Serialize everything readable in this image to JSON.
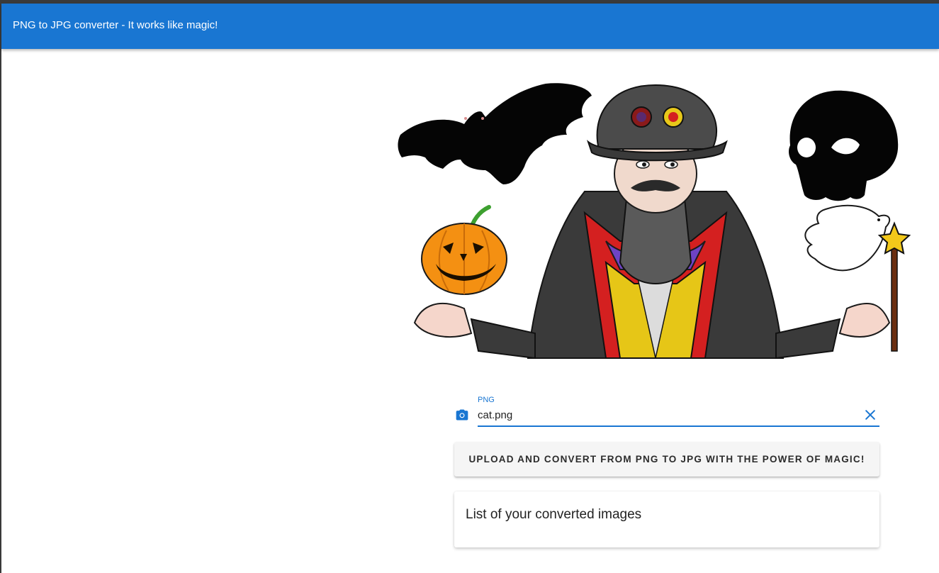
{
  "app": {
    "title": "PNG to JPG converter - It works like magic!"
  },
  "hero": {
    "icons": [
      "bat-icon",
      "magician-icon",
      "skull-icon",
      "pumpkin-icon",
      "dove-icon",
      "magic-wand-icon"
    ]
  },
  "upload": {
    "field_label": "PNG",
    "file_value": "cat.png",
    "prepend_icon": "camera-icon",
    "clear_icon": "close-icon"
  },
  "convert_button": {
    "label": "UPLOAD AND CONVERT FROM PNG TO JPG WITH THE POWER OF MAGIC!"
  },
  "converted_list": {
    "title": "List of your converted images"
  },
  "colors": {
    "primary": "#1976d2",
    "button_bg": "#f5f5f5"
  }
}
